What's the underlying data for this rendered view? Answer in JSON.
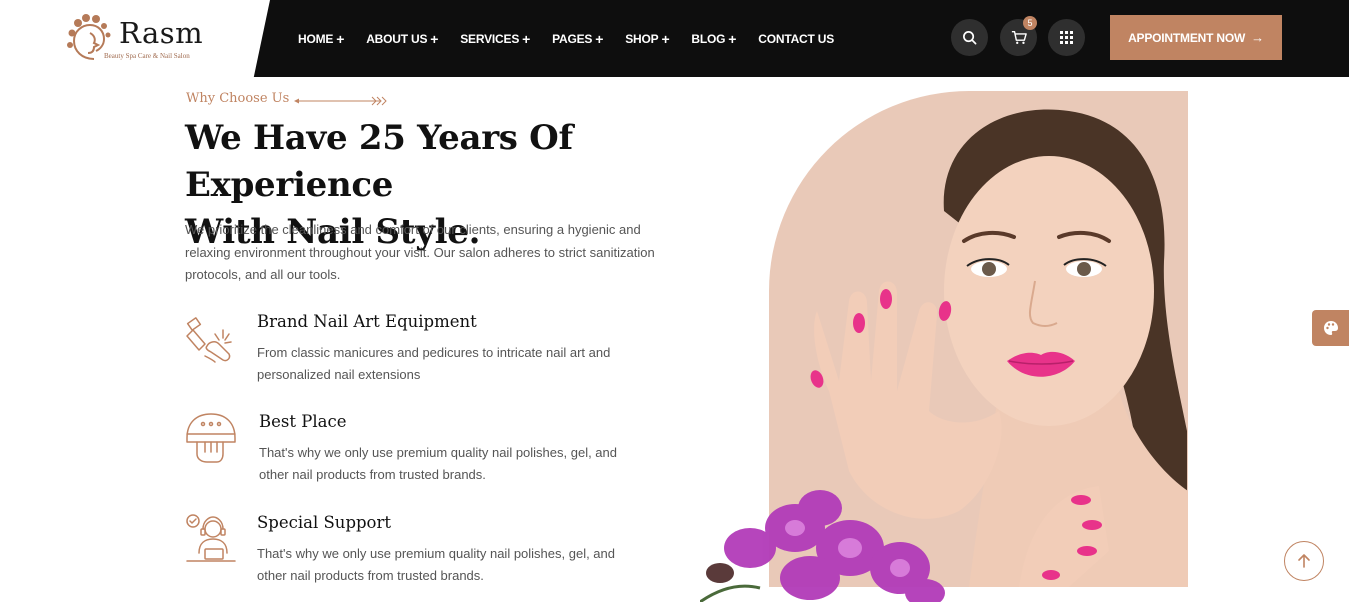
{
  "brand": {
    "name": "Rasm",
    "tagline": "Beauty Spa Care & Nail Salon"
  },
  "nav": {
    "items": [
      {
        "label": "HOME",
        "has_submenu": true
      },
      {
        "label": "ABOUT US",
        "has_submenu": true
      },
      {
        "label": "SERVICES",
        "has_submenu": true
      },
      {
        "label": "PAGES",
        "has_submenu": true
      },
      {
        "label": "SHOP",
        "has_submenu": true
      },
      {
        "label": "BLOG",
        "has_submenu": true
      },
      {
        "label": "CONTACT US",
        "has_submenu": false
      }
    ],
    "plus_glyph": "+"
  },
  "header_actions": {
    "search_icon": "search-icon",
    "cart_icon": "cart-icon",
    "cart_count": "5",
    "menu_icon": "grid-icon",
    "appointment_label": "APPOINTMENT NOW",
    "appointment_arrow": "→"
  },
  "section": {
    "eyebrow": "Why Choose Us",
    "heading_line1": "We Have 25 Years Of Experience",
    "heading_line2": "With Nail Style.",
    "intro": "We prioritize the cleanliness and comfort of our clients, ensuring a hygienic and relaxing environment throughout your visit. Our salon adheres to strict sanitization protocols, and all our tools."
  },
  "features": [
    {
      "icon": "nail-polish-icon",
      "title": "Brand Nail Art Equipment",
      "description": "From classic manicures and pedicures to intricate nail art and personalized nail extensions"
    },
    {
      "icon": "nail-dryer-icon",
      "title": "Best Place",
      "description": "That's why we only use premium quality nail polishes, gel, and other nail products from trusted brands."
    },
    {
      "icon": "support-agent-icon",
      "title": "Special Support",
      "description": "That's why we only use premium quality nail polishes, gel, and other nail products from trusted brands."
    }
  ],
  "floating": {
    "palette_icon": "palette-icon",
    "scroll_top_icon": "arrow-up-icon"
  },
  "colors": {
    "accent": "#c08462",
    "header_bg": "#0e0e0e",
    "photo_bg": "#e9c9b8",
    "nail_pink": "#e8338a",
    "orchid": "#b23bb8"
  }
}
